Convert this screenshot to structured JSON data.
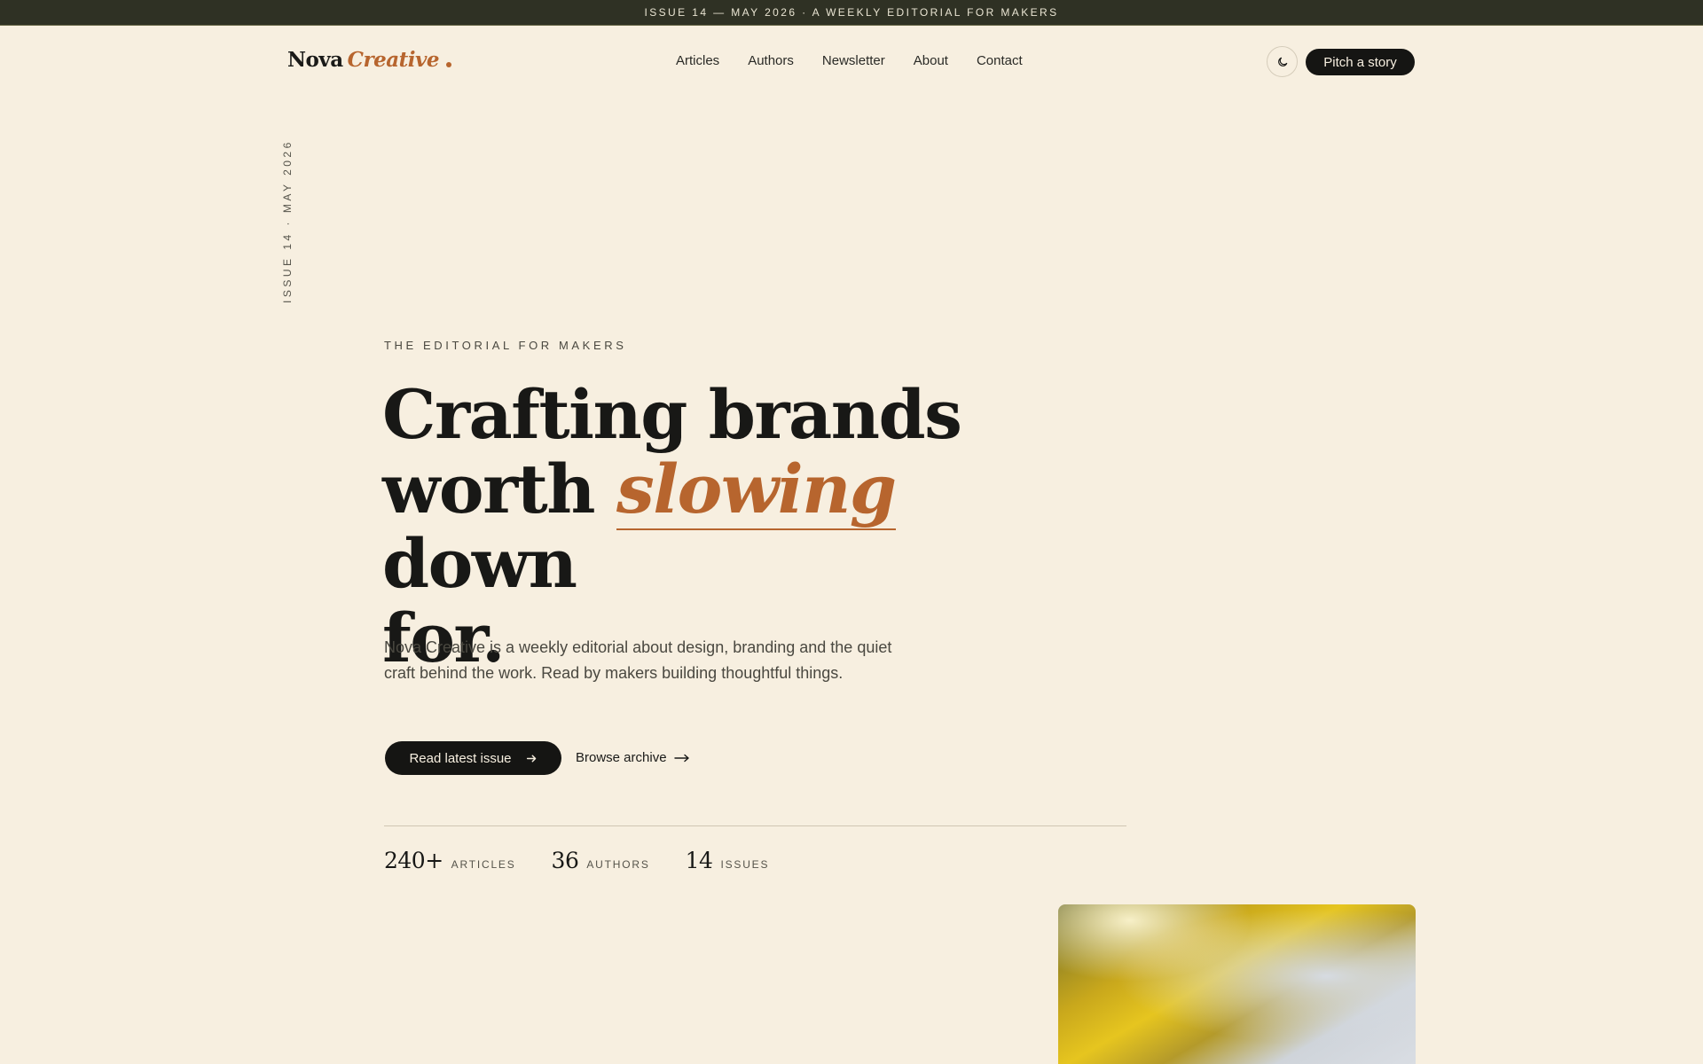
{
  "announcement": "ISSUE 14 — MAY 2026 · A WEEKLY EDITORIAL FOR MAKERS",
  "brand": {
    "name_part1": "Nova",
    "name_part2": "Creative"
  },
  "nav": {
    "items": [
      "Articles",
      "Authors",
      "Newsletter",
      "About",
      "Contact"
    ]
  },
  "header": {
    "theme_icon": "moon-icon",
    "pitch_label": "Pitch a story"
  },
  "side_label": "ISSUE 14 · MAY 2026",
  "hero": {
    "eyebrow": "THE EDITORIAL FOR MAKERS",
    "headline_1": "Crafting brands",
    "headline_2": "worth",
    "headline_accent": "slowing",
    "headline_3": "down",
    "headline_4": "for.",
    "lede": "Nova Creative is a weekly editorial about design, branding and the quiet craft behind the work. Read by makers building thoughtful things.",
    "primary_cta": "Read latest issue",
    "secondary_cta": "Browse archive"
  },
  "stats": [
    {
      "value": "240+",
      "label": "ARTICLES"
    },
    {
      "value": "36",
      "label": "AUTHORS"
    },
    {
      "value": "14",
      "label": "ISSUES"
    }
  ],
  "colors": {
    "background": "#f7efe0",
    "accent": "#b7652e",
    "ink": "#151513",
    "topbar": "#2f3124"
  }
}
